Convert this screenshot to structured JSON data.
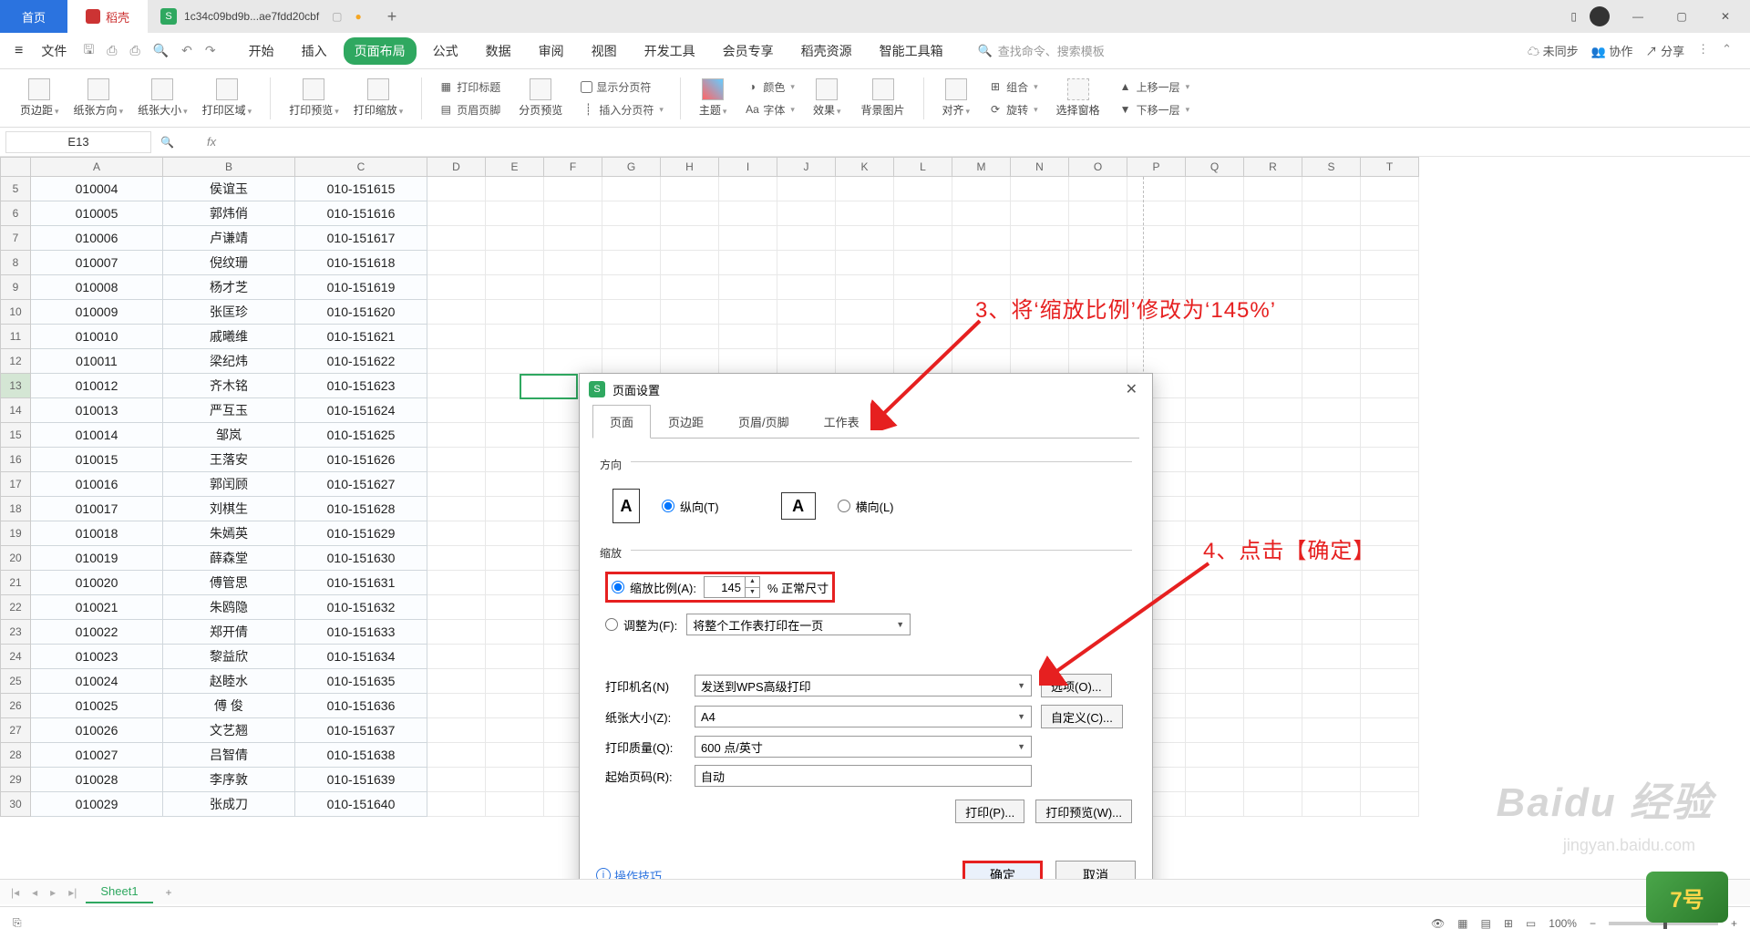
{
  "titlebar": {
    "home": "首页",
    "doc": "稻壳",
    "file": "1c34c09bd9b...ae7fdd20cbf"
  },
  "menubar": {
    "file": "文件",
    "items": [
      "开始",
      "插入",
      "页面布局",
      "公式",
      "数据",
      "审阅",
      "视图",
      "开发工具",
      "会员专享",
      "稻壳资源",
      "智能工具箱"
    ],
    "active": 2,
    "search_ph": "查找命令、搜索模板",
    "unsync": "未同步",
    "coop": "协作",
    "share": "分享"
  },
  "ribbon": {
    "g1": [
      "页边距",
      "纸张方向",
      "纸张大小",
      "打印区域"
    ],
    "g2": [
      "打印预览",
      "打印缩放"
    ],
    "g3a": "打印标题",
    "g3b": "页眉页脚",
    "g3c": "分页预览",
    "g3d": "显示分页符",
    "g3e": "插入分页符",
    "g4a": "主题",
    "g4b1": "颜色",
    "g4b2": "字体",
    "g4c": "效果",
    "g4d": "背景图片",
    "g5a": "对齐",
    "g5b1": "组合",
    "g5b2": "旋转",
    "g5c": "选择窗格",
    "g5d1": "上移一层",
    "g5d2": "下移一层"
  },
  "namebox": "E13",
  "columns": [
    "A",
    "B",
    "C",
    "D",
    "E",
    "F",
    "G",
    "H",
    "I",
    "J",
    "K",
    "L",
    "M",
    "N",
    "O",
    "P",
    "Q",
    "R",
    "S",
    "T"
  ],
  "row_start": 5,
  "rows": [
    [
      "010004",
      "侯谊玉",
      "010-151615"
    ],
    [
      "010005",
      "郭炜俏",
      "010-151616"
    ],
    [
      "010006",
      "卢谦靖",
      "010-151617"
    ],
    [
      "010007",
      "倪纹珊",
      "010-151618"
    ],
    [
      "010008",
      "杨才芝",
      "010-151619"
    ],
    [
      "010009",
      "张匡珍",
      "010-151620"
    ],
    [
      "010010",
      "戚曦维",
      "010-151621"
    ],
    [
      "010011",
      "梁纪炜",
      "010-151622"
    ],
    [
      "010012",
      "齐木铭",
      "010-151623"
    ],
    [
      "010013",
      "严互玉",
      "010-151624"
    ],
    [
      "010014",
      "邹岚",
      "010-151625"
    ],
    [
      "010015",
      "王落安",
      "010-151626"
    ],
    [
      "010016",
      "郭闰顾",
      "010-151627"
    ],
    [
      "010017",
      "刘棋生",
      "010-151628"
    ],
    [
      "010018",
      "朱嫣英",
      "010-151629"
    ],
    [
      "010019",
      "薛森堂",
      "010-151630"
    ],
    [
      "010020",
      "傅管思",
      "010-151631"
    ],
    [
      "010021",
      "朱鸥隐",
      "010-151632"
    ],
    [
      "010022",
      "郑开倩",
      "010-151633"
    ],
    [
      "010023",
      "黎益欣",
      "010-151634"
    ],
    [
      "010024",
      "赵睦水",
      "010-151635"
    ],
    [
      "010025",
      "傅 俊",
      "010-151636"
    ],
    [
      "010026",
      "文艺翘",
      "010-151637"
    ],
    [
      "010027",
      "吕智倩",
      "010-151638"
    ],
    [
      "010028",
      "李序敦",
      "010-151639"
    ],
    [
      "010029",
      "张成刀",
      "010-151640"
    ]
  ],
  "dialog": {
    "title": "页面设置",
    "tabs": [
      "页面",
      "页边距",
      "页眉/页脚",
      "工作表"
    ],
    "orient_label": "方向",
    "portrait": "纵向(T)",
    "landscape": "横向(L)",
    "scale_label": "缩放",
    "scale_ratio": "缩放比例(A):",
    "scale_value": "145",
    "pct_normal": "% 正常尺寸",
    "fit_to": "调整为(F):",
    "fit_option": "将整个工作表打印在一页",
    "printer_label": "打印机名(N)",
    "printer_value": "发送到WPS高级打印",
    "options_btn": "选项(O)...",
    "paper_label": "纸张大小(Z):",
    "paper_value": "A4",
    "custom_btn": "自定义(C)...",
    "quality_label": "打印质量(Q):",
    "quality_value": "600 点/英寸",
    "startpage_label": "起始页码(R):",
    "startpage_value": "自动",
    "print_btn": "打印(P)...",
    "preview_btn": "打印预览(W)...",
    "tip": "操作技巧",
    "ok": "确定",
    "cancel": "取消"
  },
  "annot": {
    "a3": "3、将‘缩放比例’修改为‘145%’",
    "a4": "4、点击【确定】"
  },
  "sheet_tab": "Sheet1",
  "zoom": "100%",
  "watermark": "Baidu 经验",
  "watermark2": "jingyan.baidu.com"
}
